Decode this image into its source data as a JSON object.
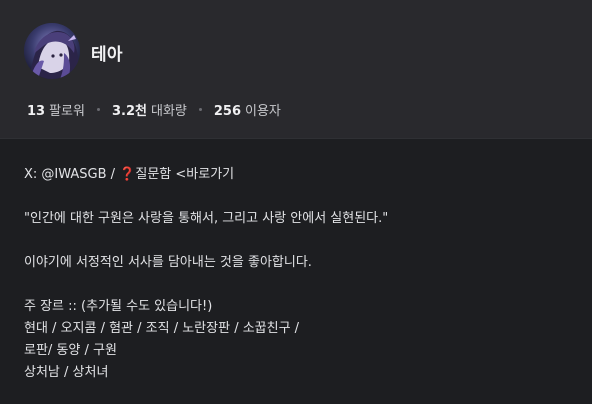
{
  "profile": {
    "name": "테아",
    "stats": [
      {
        "value": "13",
        "label": "팔로워"
      },
      {
        "value": "3.2천",
        "label": "대화량"
      },
      {
        "value": "256",
        "label": "이용자"
      }
    ]
  },
  "bio": {
    "line1_prefix": "X: @IWASGB / ",
    "line1_icon": "❓",
    "line1_suffix": "질문함 <바로가기",
    "quote": "\"인간에 대한 구원은 사랑을 통해서, 그리고 사랑 안에서 실현된다.\"",
    "intro": "이야기에 서정적인 서사를 담아내는 것을 좋아합니다.",
    "genre_title": "주 장르 :: (추가될 수도 있습니다!)",
    "genre_lines": [
      "현대 / 오지콤 / 혐관 / 조직 / 노란장판 / 소꿉친구 /",
      "로판/ 동양 / 구원",
      "상처남 / 상처녀"
    ]
  },
  "icons": {
    "avatar": "profile-avatar",
    "question": "question-mark-icon"
  },
  "colors": {
    "header_bg": "#29292d",
    "body_bg": "#1d1e21",
    "text": "#e2e3e6"
  }
}
